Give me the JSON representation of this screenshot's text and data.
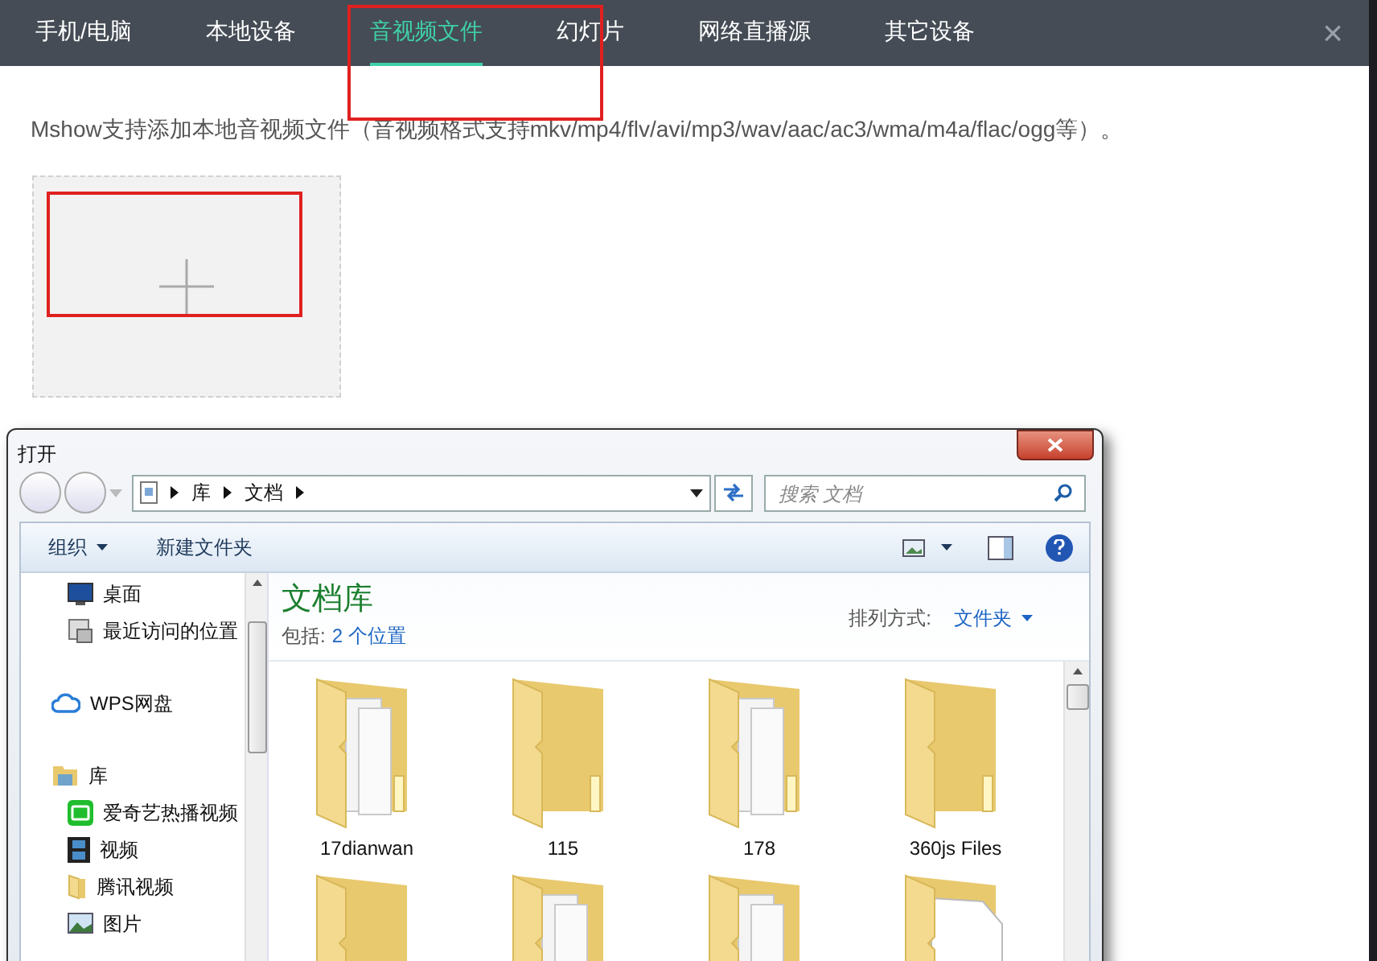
{
  "tabs": [
    {
      "label": "手机/电脑",
      "selected": false
    },
    {
      "label": "本地设备",
      "selected": false
    },
    {
      "label": "音视频文件",
      "selected": true
    },
    {
      "label": "幻灯片",
      "selected": false
    },
    {
      "label": "网络直播源",
      "selected": false
    },
    {
      "label": "其它设备",
      "selected": false
    }
  ],
  "close": "×",
  "description": "Mshow支持添加本地音视频文件（音视频格式支持mkv/mp4/flv/avi/mp3/wav/aac/ac3/wma/m4a/flac/ogg等）。",
  "dialog": {
    "title": "打开",
    "breadcrumb": [
      "库",
      "文档"
    ],
    "search": {
      "placeholder": "搜索 文档"
    },
    "toolbar": {
      "organize": "组织",
      "new_folder": "新建文件夹"
    },
    "nav": [
      {
        "children": [
          {
            "label": "桌面",
            "kind": "desktop"
          },
          {
            "label": "最近访问的位置",
            "kind": "recent"
          }
        ]
      },
      {
        "label": "WPS网盘",
        "kind": "cloud"
      },
      {
        "label": "库",
        "kind": "library",
        "children": [
          {
            "label": "爱奇艺热播视频",
            "kind": "iqiyi"
          },
          {
            "label": "视频",
            "kind": "video"
          },
          {
            "label": "腾讯视频",
            "kind": "folder"
          },
          {
            "label": "图片",
            "kind": "pictures"
          }
        ]
      }
    ],
    "library_title": "文档库",
    "includes_label": "包括:",
    "includes_link": "2 个位置",
    "sort_label": "排列方式:",
    "sort_value": "文件夹",
    "folders": [
      {
        "label": "17dianwan",
        "kind": "documents"
      },
      {
        "label": "115",
        "kind": "plain"
      },
      {
        "label": "178",
        "kind": "documents"
      },
      {
        "label": "360js Files",
        "kind": "plain"
      },
      {
        "kind": "plain"
      },
      {
        "kind": "documents"
      },
      {
        "kind": "documents"
      },
      {
        "kind": "paper"
      }
    ]
  }
}
